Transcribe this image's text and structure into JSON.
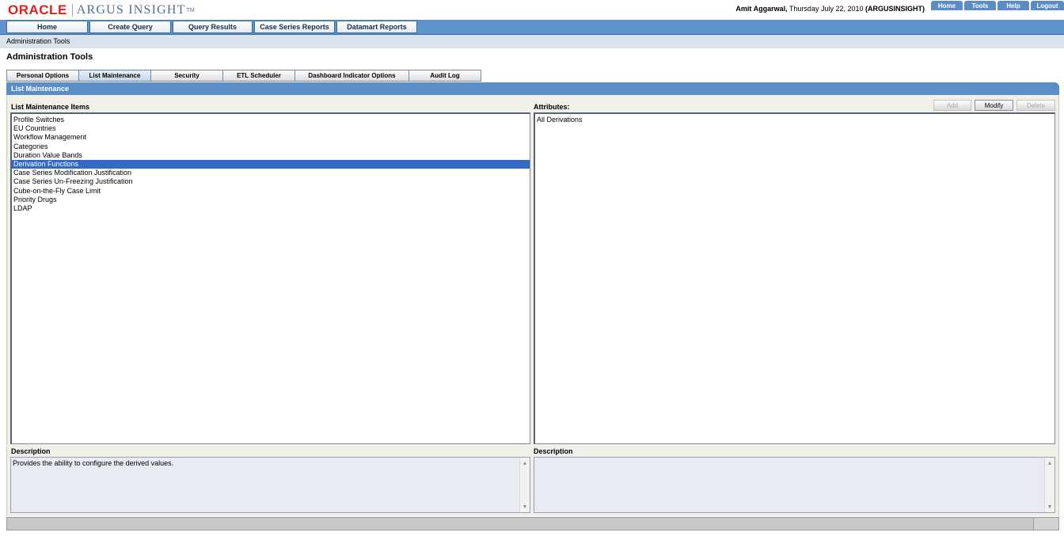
{
  "header": {
    "brand_oracle": "ORACLE",
    "brand_product": "ARGUS INSIGHT",
    "brand_tm": "TM",
    "user_name": "Amit Aggarwal,",
    "date_text": " Thursday July 22, 2010 ",
    "instance": "(ARGUSINSIGHT)",
    "links": [
      "Home",
      "Tools",
      "Help",
      "Logout"
    ]
  },
  "nav": {
    "items": [
      "Home",
      "Create Query",
      "Query Results",
      "Case Series Reports",
      "Datamart Reports"
    ]
  },
  "breadcrumb": "Administration Tools",
  "page_title": "Administration Tools",
  "tabs": [
    "Personal Options",
    "List Maintenance",
    "Security",
    "ETL Scheduler",
    "Dashboard Indicator Options",
    "Audit Log"
  ],
  "active_tab": "List Maintenance",
  "section_title": "List Maintenance",
  "left_panel": {
    "label": "List Maintenance Items",
    "items": [
      "Profile Switches",
      "EU Countries",
      "Workflow Management",
      "Categories",
      "Duration Value Bands",
      "Derivation Functions",
      "Case Series Modification Justification",
      "Case Series Un-Freezing Justification",
      "Cube-on-the-Fly Case Limit",
      "Priority Drugs",
      "LDAP"
    ],
    "selected": "Derivation Functions",
    "description_label": "Description",
    "description_text": "Provides the ability to configure the derived values."
  },
  "right_panel": {
    "label": "Attributes:",
    "buttons": {
      "add": "Add",
      "modify": "Modify",
      "delete": "Delete"
    },
    "items": [
      "All Derivations"
    ],
    "description_label": "Description",
    "description_text": ""
  },
  "colors": {
    "nav_blue": "#5f93cc",
    "selection": "#316ac5",
    "oracle_red": "#e0201b"
  }
}
